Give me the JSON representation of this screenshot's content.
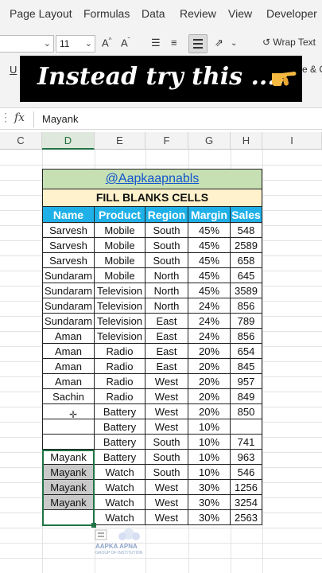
{
  "ribbon": {
    "tabs": [
      "Page Layout",
      "Formulas",
      "Data",
      "Review",
      "View",
      "Developer"
    ],
    "font_size": "11",
    "wrap_text_label": "Wrap Text",
    "underline_label": "U",
    "merge_label": "e & C"
  },
  "banner": {
    "text": "Instead try this ....",
    "icon": "pointing-hand-emoji"
  },
  "formula_bar": {
    "fx_label": "fx",
    "value": "Mayank"
  },
  "columns": [
    "C",
    "D",
    "E",
    "F",
    "G",
    "H",
    "I"
  ],
  "table": {
    "title": "@Aapkaapnabls",
    "subtitle": "FILL BLANKS CELLS",
    "headers": [
      "Name",
      "Product",
      "Region",
      "Margin",
      "Sales"
    ],
    "rows": [
      [
        "Sarvesh",
        "Mobile",
        "South",
        "45%",
        "548"
      ],
      [
        "Sarvesh",
        "Mobile",
        "South",
        "45%",
        "2589"
      ],
      [
        "Sarvesh",
        "Mobile",
        "South",
        "45%",
        "658"
      ],
      [
        "Sundaram",
        "Mobile",
        "North",
        "45%",
        "645"
      ],
      [
        "Sundaram",
        "Television",
        "North",
        "45%",
        "3589"
      ],
      [
        "Sundaram",
        "Television",
        "North",
        "24%",
        "856"
      ],
      [
        "Sundaram",
        "Television",
        "East",
        "24%",
        "789"
      ],
      [
        "Aman",
        "Television",
        "East",
        "24%",
        "856"
      ],
      [
        "Aman",
        "Radio",
        "East",
        "20%",
        "654"
      ],
      [
        "Aman",
        "Radio",
        "East",
        "20%",
        "845"
      ],
      [
        "Aman",
        "Radio",
        "West",
        "20%",
        "957"
      ],
      [
        "Sachin",
        "Radio",
        "West",
        "20%",
        "849"
      ],
      [
        "",
        "Battery",
        "West",
        "20%",
        "850"
      ],
      [
        "",
        "Battery",
        "West",
        "10%",
        ""
      ],
      [
        "",
        "Battery",
        "South",
        "10%",
        "741"
      ],
      [
        "Mayank",
        "Battery",
        "South",
        "10%",
        "963"
      ],
      [
        "Mayank",
        "Watch",
        "South",
        "10%",
        "546"
      ],
      [
        "Mayank",
        "Watch",
        "West",
        "30%",
        "1256"
      ],
      [
        "Mayank",
        "Watch",
        "West",
        "30%",
        "3254"
      ],
      [
        "",
        "Watch",
        "West",
        "30%",
        "2563"
      ]
    ]
  },
  "watermark": {
    "text": "AAPKA APNA",
    "sub": "GROUP OF INSTITUTION"
  },
  "colors": {
    "title_bg": "#c6e0b4",
    "subtitle_bg": "#fff2cc",
    "header_bg": "#1fb0e8",
    "selection": "#217346"
  }
}
